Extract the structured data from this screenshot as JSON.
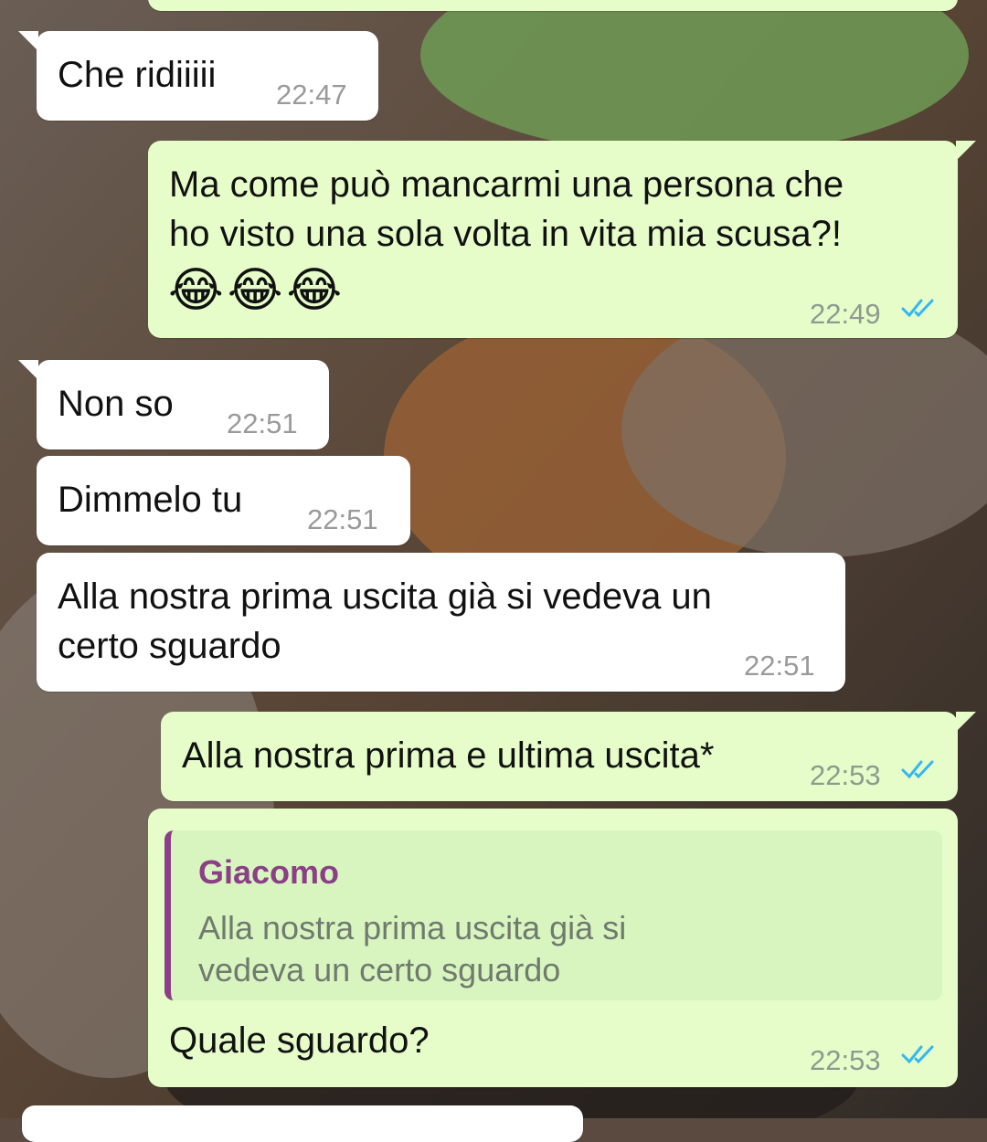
{
  "colors": {
    "incoming_bubble": "#ffffff",
    "outgoing_bubble": "#e6fdc9",
    "read_ticks": "#34b7f1",
    "quote_accent": "#8a3f86"
  },
  "messages": [
    {
      "id": "m1",
      "direction": "incoming",
      "text": "Che ridiiiii",
      "time": "22:47"
    },
    {
      "id": "m2",
      "direction": "outgoing",
      "lines": [
        "Ma come può mancarmi una persona che",
        "ho visto una sola volta in vita mia scusa?!"
      ],
      "emoji": [
        "😂",
        "😂",
        "😂"
      ],
      "time": "22:49",
      "status": "read"
    },
    {
      "id": "m3",
      "direction": "incoming",
      "text": "Non so",
      "time": "22:51"
    },
    {
      "id": "m4",
      "direction": "incoming",
      "text": "Dimmelo tu",
      "time": "22:51"
    },
    {
      "id": "m5",
      "direction": "incoming",
      "lines": [
        "Alla nostra prima uscita già si vedeva un",
        "certo sguardo"
      ],
      "time": "22:51"
    },
    {
      "id": "m6",
      "direction": "outgoing",
      "text": "Alla nostra prima e ultima uscita*",
      "time": "22:53",
      "status": "read"
    },
    {
      "id": "m7",
      "direction": "outgoing",
      "quote": {
        "author": "Giacomo",
        "lines": [
          "Alla nostra prima uscita già si",
          "vedeva un certo sguardo"
        ]
      },
      "text": "Quale sguardo?",
      "time": "22:53",
      "status": "read"
    }
  ],
  "icons": {
    "read_receipt": "double-check-icon"
  }
}
